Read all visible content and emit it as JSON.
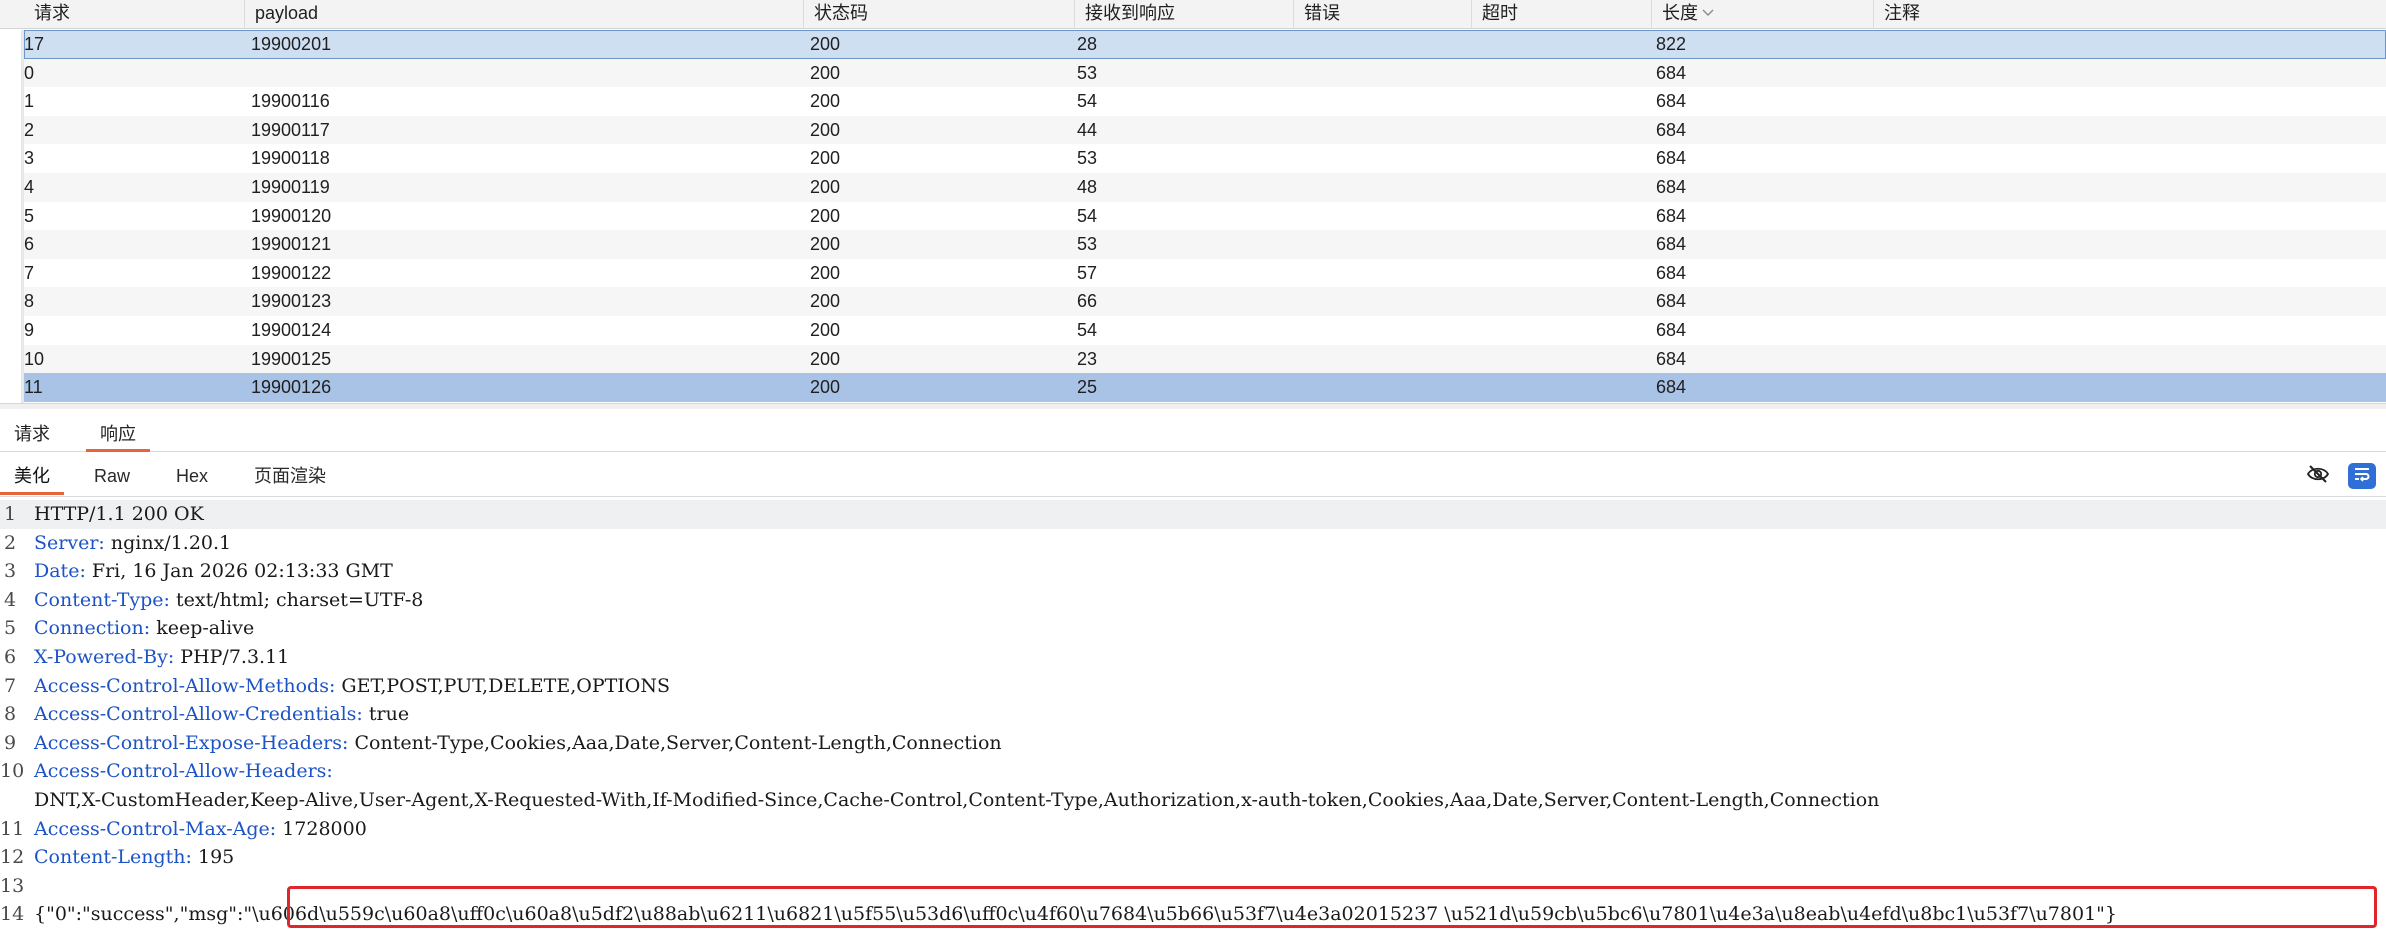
{
  "table": {
    "columns": [
      {
        "label": "请求"
      },
      {
        "label": "payload"
      },
      {
        "label": "状态码"
      },
      {
        "label": "接收到响应"
      },
      {
        "label": "错误"
      },
      {
        "label": "超时"
      },
      {
        "label": "长度"
      },
      {
        "label": "注释"
      }
    ],
    "rows": [
      {
        "req": "17",
        "payload": "19900201",
        "status": "200",
        "resp": "28",
        "error": "",
        "timeout": "",
        "length": "822",
        "comment": ""
      },
      {
        "req": "0",
        "payload": "",
        "status": "200",
        "resp": "53",
        "error": "",
        "timeout": "",
        "length": "684",
        "comment": ""
      },
      {
        "req": "1",
        "payload": "19900116",
        "status": "200",
        "resp": "54",
        "error": "",
        "timeout": "",
        "length": "684",
        "comment": ""
      },
      {
        "req": "2",
        "payload": "19900117",
        "status": "200",
        "resp": "44",
        "error": "",
        "timeout": "",
        "length": "684",
        "comment": ""
      },
      {
        "req": "3",
        "payload": "19900118",
        "status": "200",
        "resp": "53",
        "error": "",
        "timeout": "",
        "length": "684",
        "comment": ""
      },
      {
        "req": "4",
        "payload": "19900119",
        "status": "200",
        "resp": "48",
        "error": "",
        "timeout": "",
        "length": "684",
        "comment": ""
      },
      {
        "req": "5",
        "payload": "19900120",
        "status": "200",
        "resp": "54",
        "error": "",
        "timeout": "",
        "length": "684",
        "comment": ""
      },
      {
        "req": "6",
        "payload": "19900121",
        "status": "200",
        "resp": "53",
        "error": "",
        "timeout": "",
        "length": "684",
        "comment": ""
      },
      {
        "req": "7",
        "payload": "19900122",
        "status": "200",
        "resp": "57",
        "error": "",
        "timeout": "",
        "length": "684",
        "comment": ""
      },
      {
        "req": "8",
        "payload": "19900123",
        "status": "200",
        "resp": "66",
        "error": "",
        "timeout": "",
        "length": "684",
        "comment": ""
      },
      {
        "req": "9",
        "payload": "19900124",
        "status": "200",
        "resp": "54",
        "error": "",
        "timeout": "",
        "length": "684",
        "comment": ""
      },
      {
        "req": "10",
        "payload": "19900125",
        "status": "200",
        "resp": "23",
        "error": "",
        "timeout": "",
        "length": "684",
        "comment": ""
      },
      {
        "req": "11",
        "payload": "19900126",
        "status": "200",
        "resp": "25",
        "error": "",
        "timeout": "",
        "length": "684",
        "comment": ""
      }
    ],
    "sorted_column": "长度",
    "sort_icon": "chevron-down-icon"
  },
  "tabs": {
    "top": [
      {
        "label": "请求",
        "active": false
      },
      {
        "label": "响应",
        "active": true
      }
    ],
    "sub": [
      {
        "label": "美化",
        "active": true
      },
      {
        "label": "Raw",
        "active": false
      },
      {
        "label": "Hex",
        "active": false
      },
      {
        "label": "页面渲染",
        "active": false
      }
    ],
    "tool_icons": [
      "eye-slash-icon",
      "word-wrap-icon"
    ]
  },
  "response": {
    "lines": [
      {
        "num": "1",
        "name": "",
        "sep": "",
        "value": "HTTP/1.1 200 OK"
      },
      {
        "num": "2",
        "name": "Server",
        "sep": ": ",
        "value": "nginx/1.20.1"
      },
      {
        "num": "3",
        "name": "Date",
        "sep": ": ",
        "value": "Fri, 16 Jan 2026 02:13:33 GMT"
      },
      {
        "num": "4",
        "name": "Content-Type",
        "sep": ": ",
        "value": "text/html; charset=UTF-8"
      },
      {
        "num": "5",
        "name": "Connection",
        "sep": ": ",
        "value": "keep-alive"
      },
      {
        "num": "6",
        "name": "X-Powered-By",
        "sep": ": ",
        "value": "PHP/7.3.11"
      },
      {
        "num": "7",
        "name": "Access-Control-Allow-Methods",
        "sep": ": ",
        "value": "GET,POST,PUT,DELETE,OPTIONS"
      },
      {
        "num": "8",
        "name": "Access-Control-Allow-Credentials",
        "sep": ": ",
        "value": "true"
      },
      {
        "num": "9",
        "name": "Access-Control-Expose-Headers",
        "sep": ": ",
        "value": "Content-Type,Cookies,Aaa,Date,Server,Content-Length,Connection"
      },
      {
        "num": "10",
        "name": "Access-Control-Allow-Headers",
        "sep": ":",
        "value": ""
      },
      {
        "num": "",
        "name": "",
        "sep": "",
        "value": "DNT,X-CustomHeader,Keep-Alive,User-Agent,X-Requested-With,If-Modified-Since,Cache-Control,Content-Type,Authorization,x-auth-token,Cookies,Aaa,Date,Server,Content-Length,Connection"
      },
      {
        "num": "11",
        "name": "Access-Control-Max-Age",
        "sep": ": ",
        "value": "1728000"
      },
      {
        "num": "12",
        "name": "Content-Length",
        "sep": ": ",
        "value": "195"
      },
      {
        "num": "13",
        "name": "",
        "sep": "",
        "value": ""
      },
      {
        "num": "14",
        "name": "",
        "sep": "",
        "value": "{\"0\":\"success\",\"msg\":\"\\u606d\\u559c\\u60a8\\uff0c\\u60a8\\u5df2\\u88ab\\u6211\\u6821\\u5f55\\u53d6\\uff0c\\u4f60\\u7684\\u5b66\\u53f7\\u4e3a02015237 \\u521d\\u59cb\\u5bc6\\u7801\\u4e3a\\u8eab\\u4efd\\u8bc1\\u53f7\\u7801\"}"
      }
    ]
  },
  "colors": {
    "accent_tab_underline": "#e5643a",
    "header_name": "#1c53c5",
    "selected_row_light": "#cfdff2",
    "selected_row_dark": "#a9c3e6",
    "highlight_box": "#e0252b"
  }
}
